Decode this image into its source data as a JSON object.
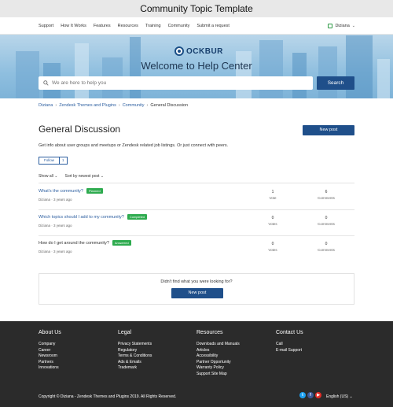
{
  "caption": "Community Topic Template",
  "nav": {
    "links": [
      "Support",
      "How It Works",
      "Features",
      "Resources",
      "Training",
      "Community",
      "Submit a request"
    ],
    "user": "Diziana"
  },
  "hero": {
    "logo": "OCKBUR",
    "title": "Welcome to Help Center",
    "search_placeholder": "We are here to help you",
    "search_button": "Search"
  },
  "breadcrumb": [
    "Diziana",
    "Zendesk Themes and Plugins",
    "Community",
    "General Discussion"
  ],
  "topic": {
    "title": "General Discussion",
    "new_post_label": "New post",
    "description": "Get info about user groups and meetups or Zendesk related job listings. Or just connect with peers.",
    "follow_label": "Follow",
    "follow_count": "1",
    "filter_show": "Show all",
    "filter_sort": "Sort by newest post"
  },
  "posts": [
    {
      "title": "What's the community?",
      "status": "Planned",
      "author": "Diziana",
      "age": "3 years ago",
      "votes": "1",
      "votes_label": "Vote",
      "comments": "6",
      "comments_label": "Comments",
      "linked": true
    },
    {
      "title": "Which topics should I add to my community?",
      "status": "Completed",
      "author": "Diziana",
      "age": "3 years ago",
      "votes": "0",
      "votes_label": "Votes",
      "comments": "0",
      "comments_label": "Comments",
      "linked": true
    },
    {
      "title": "How do I get around the community?",
      "status": "Answered",
      "author": "Diziana",
      "age": "3 years ago",
      "votes": "0",
      "votes_label": "Votes",
      "comments": "0",
      "comments_label": "Comments",
      "linked": false
    }
  ],
  "not_found": {
    "text": "Didn't find what you were looking for?",
    "button": "New post"
  },
  "footer": {
    "columns": [
      {
        "heading": "About Us",
        "links": [
          "Company",
          "Career",
          "Newsroom",
          "Partners",
          "Innovations"
        ]
      },
      {
        "heading": "Legal",
        "links": [
          "Privacy Statements",
          "Regulatory",
          "Terms & Conditions",
          "Ads & Emails",
          "Trademark"
        ]
      },
      {
        "heading": "Resources",
        "links": [
          "Downloads and Manuals",
          "Articles",
          "Accessibility",
          "Partner Opportunity",
          "Warranty Policy",
          "Support Site Map"
        ]
      },
      {
        "heading": "Contact Us",
        "links": [
          "Call",
          "E-mail Support"
        ]
      }
    ],
    "copyright": "Copyright © Diziana - Zendesk Themes and Plugins 2019. All Rights Reserved.",
    "social": [
      {
        "icon": "twitter-icon",
        "glyph": "t",
        "color": "#1da1f2"
      },
      {
        "icon": "facebook-icon",
        "glyph": "f",
        "color": "#3b5998"
      },
      {
        "icon": "youtube-icon",
        "glyph": "▶",
        "color": "#e52d27"
      }
    ],
    "language": "English (US)"
  },
  "colors": {
    "primary": "#1f4f8a",
    "link": "#2d5fa0",
    "badge": "#2eab4f",
    "footer_bg": "#2b2b2b"
  }
}
